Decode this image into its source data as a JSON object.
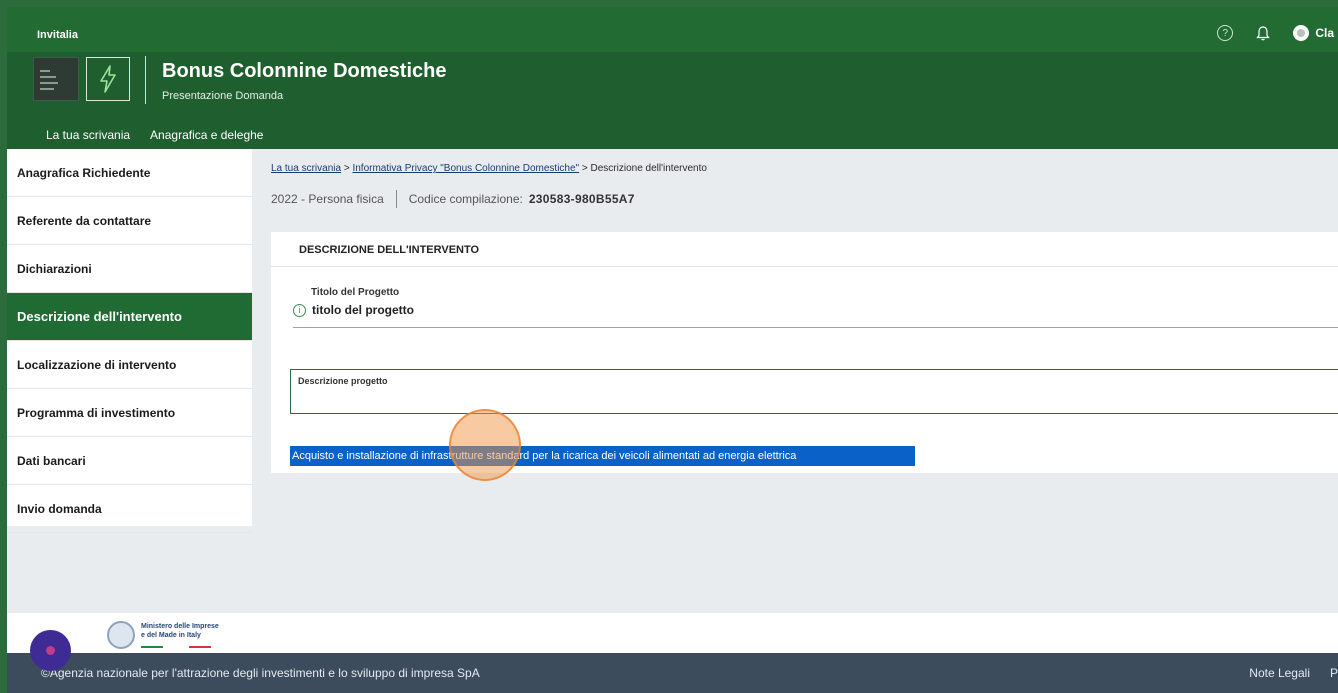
{
  "topbar": {
    "brand": "Invitalia",
    "help_icon": "question-circle-icon",
    "notifications_icon": "bell-icon",
    "user_name": "Cla"
  },
  "header": {
    "title": "Bonus Colonnine Domestiche",
    "subtitle": "Presentazione Domanda",
    "nav": [
      "La tua scrivania",
      "Anagrafica e deleghe"
    ]
  },
  "sidebar": {
    "items": [
      {
        "label": "Anagrafica Richiedente",
        "active": false
      },
      {
        "label": "Referente da contattare",
        "active": false
      },
      {
        "label": "Dichiarazioni",
        "active": false
      },
      {
        "label": "Descrizione dell'intervento",
        "active": true
      },
      {
        "label": "Localizzazione di intervento",
        "active": false
      },
      {
        "label": "Programma di investimento",
        "active": false
      },
      {
        "label": "Dati bancari",
        "active": false
      },
      {
        "label": "Invio domanda",
        "active": false
      }
    ]
  },
  "breadcrumb": {
    "link1": "La tua scrivania",
    "sep": ">",
    "link2": "Informativa Privacy \"Bonus Colonnine Domestiche\"",
    "current": "Descrizione dell'intervento"
  },
  "meta": {
    "year": "2022",
    "dash": "-",
    "type": "Persona fisica",
    "code_label": "Codice compilazione:",
    "code_value": "230583-980B55A7"
  },
  "form": {
    "section_title": "DESCRIZIONE DELL'INTERVENTO",
    "title_label": "Titolo del Progetto",
    "title_value": "titolo del progetto",
    "description_label": "Descrizione progetto",
    "description_value": "",
    "suggestion": "Acquisto e installazione di infrastrutture standard per la ricarica dei veicoli alimentati ad energia elettrica"
  },
  "footer": {
    "ministry_line1": "Ministero delle Imprese",
    "ministry_line2": "e del Made in Italy",
    "copyright": "©Agenzia nazionale per l'attrazione degli investimenti e lo sviluppo di impresa SpA",
    "legal": "Note Legali",
    "extra": "P"
  },
  "colors": {
    "primary_green": "#1f5f2f",
    "active_green": "#206a33",
    "suggestion_blue": "#0a62c8",
    "footer_dark": "#3d4c5c"
  }
}
